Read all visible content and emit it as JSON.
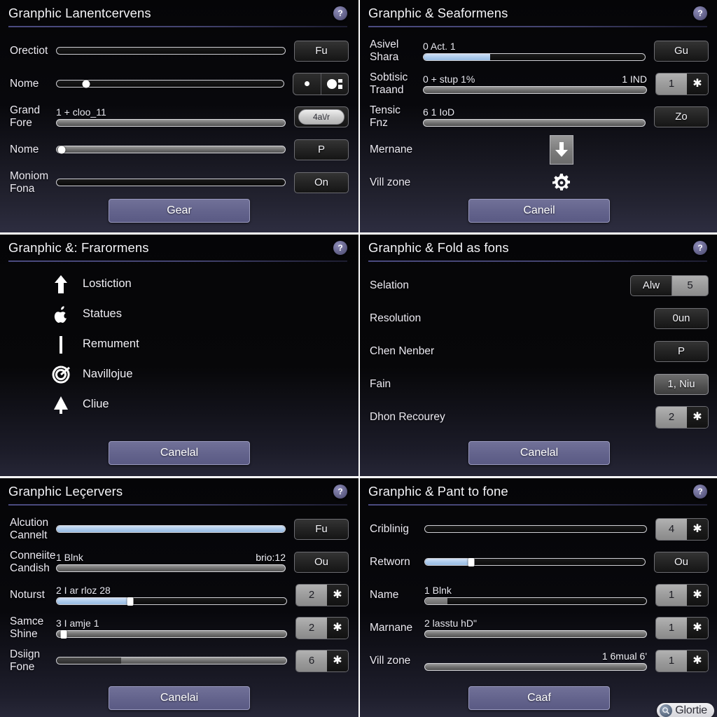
{
  "panels": [
    {
      "title": "Granphic Lanentcervens",
      "help_glyph": "?",
      "rows": [
        {
          "label": "Orectiot",
          "type": "slider",
          "value_left": "",
          "value_right": "",
          "fill": 0,
          "knob": null,
          "side": {
            "kind": "button",
            "label": "Fu"
          }
        },
        {
          "label": "Nome",
          "type": "slider",
          "value_left": "",
          "value_right": "",
          "fill": 0,
          "knob": 13,
          "side": {
            "kind": "toggle",
            "label": ""
          }
        },
        {
          "label": "Grand\nFore",
          "type": "slider",
          "value_left": "1 + cloo_11",
          "value_right": "",
          "fill": 0,
          "knob": null,
          "track": "filled",
          "side": {
            "kind": "pill",
            "label": "4a\\/r"
          }
        },
        {
          "label": "Nome",
          "type": "slider",
          "value_left": "",
          "value_right": "",
          "fill": 0,
          "knob": 2,
          "track": "filled",
          "side": {
            "kind": "button",
            "label": "P"
          }
        },
        {
          "label": "Moniom\nFona",
          "type": "slider",
          "value_left": "",
          "value_right": "",
          "fill": 0,
          "knob": null,
          "side": {
            "kind": "button",
            "label": "On"
          }
        }
      ],
      "footer_label": "Gear"
    },
    {
      "title": "Granphic & Seaformens",
      "help_glyph": "?",
      "rows": [
        {
          "label": "Asivel\nShara",
          "type": "slider",
          "value_left": "0 Act. 1",
          "value_right": "",
          "fill": 30,
          "blue": true,
          "knob": null,
          "side": {
            "kind": "button",
            "label": "Gu"
          }
        },
        {
          "label": "Sobtisic\nTraand",
          "type": "slider",
          "value_left": "0 + stup 1%",
          "value_right": "1 IND",
          "fill": 0,
          "track": "filled",
          "knob": null,
          "side": {
            "kind": "spinner",
            "value": "1",
            "step_glyph": "✱"
          }
        },
        {
          "label": "Tensic\nFnz",
          "type": "slider",
          "value_left": "6 1 IoD",
          "value_right": "",
          "fill": 0,
          "track": "filled",
          "knob": null,
          "side": {
            "kind": "button",
            "label": "Zo"
          }
        },
        {
          "label": "Mernane",
          "type": "icon",
          "icon": "download-icon"
        },
        {
          "label": "Vill zone",
          "type": "icon",
          "icon": "gear-icon"
        }
      ],
      "footer_label": "Caneil"
    },
    {
      "title": "Granphic &: Frarormens",
      "help_glyph": "?",
      "items": [
        {
          "icon": "arrow-up-icon",
          "label": "Lostiction"
        },
        {
          "icon": "apple-icon",
          "label": "Statues"
        },
        {
          "icon": "vertical-bar-icon",
          "label": "Remument"
        },
        {
          "icon": "target-icon",
          "label": "Navillojue"
        },
        {
          "icon": "tree-icon",
          "label": "Cliue"
        }
      ],
      "footer_label": "Canelal"
    },
    {
      "title": "Granphic & Fold as fons",
      "help_glyph": "?",
      "rows": [
        {
          "label": "Selation",
          "type": "none",
          "side": {
            "kind": "pair",
            "label": "Alw",
            "value": "5"
          }
        },
        {
          "label": "Resolution",
          "type": "none",
          "side": {
            "kind": "button",
            "label": "0un"
          }
        },
        {
          "label": "Chen Nenber",
          "type": "none",
          "side": {
            "kind": "button",
            "label": "P"
          }
        },
        {
          "label": "Fain",
          "type": "none",
          "side": {
            "kind": "button-light",
            "label": "1, Niu"
          }
        },
        {
          "label": "Dhon Recourey",
          "type": "none",
          "side": {
            "kind": "spinner",
            "value": "2",
            "step_glyph": "✱"
          }
        }
      ],
      "footer_label": "Canelal"
    },
    {
      "title": "Granphic Leçervers",
      "help_glyph": "?",
      "rows": [
        {
          "label": "Alcution\nCannelt",
          "type": "slider",
          "value_left": "",
          "value_right": "",
          "fill": 100,
          "blue": true,
          "knob": null,
          "side": {
            "kind": "button",
            "label": "Fu"
          }
        },
        {
          "label": "Conneiite\nCandish",
          "type": "slider",
          "value_left": "1 Blnk",
          "value_right": "brio:12",
          "fill": 0,
          "track": "filled",
          "knob": null,
          "side": {
            "kind": "button",
            "label": "Ou"
          }
        },
        {
          "label": "Noturst",
          "type": "slider",
          "value_left": "2 I ar rloz 28",
          "value_right": "",
          "fill": 32,
          "blue": true,
          "knob": 32,
          "knob_square": true,
          "side": {
            "kind": "spinner",
            "value": "2",
            "step_glyph": "✱"
          }
        },
        {
          "label": "Samce\nShine",
          "type": "slider",
          "value_left": "3 I amje 1",
          "value_right": "",
          "fill": 0,
          "track": "filled",
          "knob": 3,
          "knob_square": true,
          "side": {
            "kind": "spinner",
            "value": "2",
            "step_glyph": "✱"
          }
        },
        {
          "label": "Dsiign\nFone",
          "type": "slider",
          "value_left": "",
          "value_right": "",
          "fill": 28,
          "grey": true,
          "track": "filled",
          "knob": null,
          "side": {
            "kind": "spinner",
            "value": "6",
            "step_glyph": "✱"
          }
        }
      ],
      "footer_label": "Canelai"
    },
    {
      "title": "Granphic & Pant to fone",
      "help_glyph": "?",
      "rows": [
        {
          "label": "Criblinig",
          "type": "slider",
          "value_left": "",
          "value_right": "",
          "fill": 0,
          "knob": null,
          "side": {
            "kind": "spinner",
            "value": "4",
            "step_glyph": "✱"
          }
        },
        {
          "label": "Retworn",
          "type": "slider",
          "value_left": "",
          "value_right": "",
          "fill": 21,
          "blue": true,
          "knob": 21,
          "knob_square": true,
          "side": {
            "kind": "button",
            "label": "Ou"
          }
        },
        {
          "label": "Name",
          "type": "slider",
          "value_left": "1 Blnk",
          "value_right": "",
          "fill": 10,
          "lightgrey": true,
          "knob": null,
          "side": {
            "kind": "spinner",
            "value": "1",
            "step_glyph": "✱"
          }
        },
        {
          "label": "Marnane",
          "type": "slider",
          "value_left": "2 lasstu hD\"",
          "value_right": "",
          "fill": 0,
          "track": "filled",
          "knob": null,
          "side": {
            "kind": "spinner",
            "value": "1",
            "step_glyph": "✱"
          }
        },
        {
          "label": "Vill zone",
          "type": "slider",
          "value_left": "",
          "value_right": "1 6mual 6'",
          "fill": 0,
          "track": "filled",
          "knob": null,
          "side": {
            "kind": "spinner",
            "value": "1",
            "step_glyph": "✱"
          }
        }
      ],
      "footer_label": "Caaf"
    }
  ],
  "watermark": {
    "text": "Glortie"
  }
}
